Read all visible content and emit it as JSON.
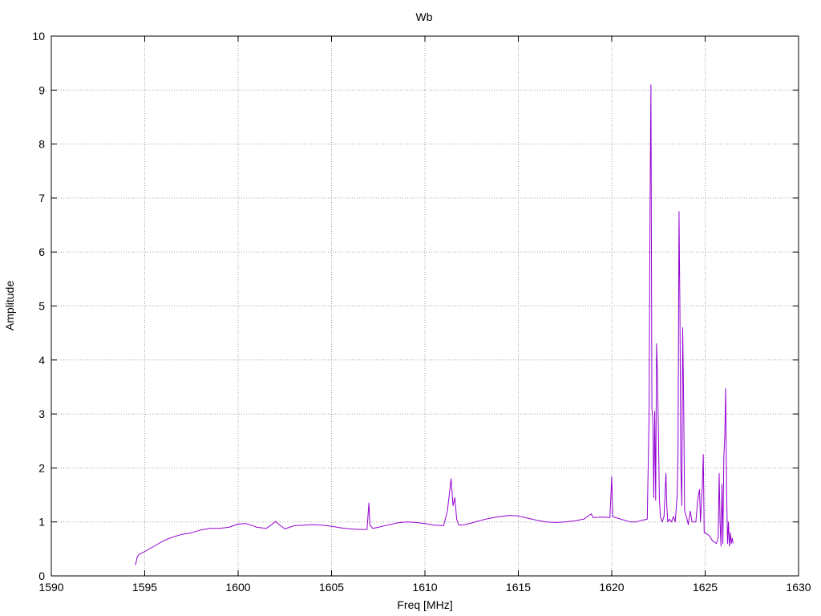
{
  "chart_data": {
    "type": "line",
    "title": "Wb",
    "xlabel": "Freq [MHz]",
    "ylabel": "Amplitude",
    "xlim": [
      1590,
      1630
    ],
    "ylim": [
      0,
      10
    ],
    "xticks": [
      1590,
      1595,
      1600,
      1605,
      1610,
      1615,
      1620,
      1625,
      1630
    ],
    "yticks": [
      0,
      1,
      2,
      3,
      4,
      5,
      6,
      7,
      8,
      9,
      10
    ],
    "grid": true,
    "legend": "none",
    "series": [
      {
        "color": "#9400d3",
        "points": [
          [
            1594.5,
            0.2
          ],
          [
            1594.6,
            0.35
          ],
          [
            1594.7,
            0.4
          ],
          [
            1595.0,
            0.45
          ],
          [
            1595.5,
            0.55
          ],
          [
            1596.0,
            0.65
          ],
          [
            1596.5,
            0.72
          ],
          [
            1597.0,
            0.77
          ],
          [
            1597.5,
            0.8
          ],
          [
            1598.0,
            0.85
          ],
          [
            1598.5,
            0.88
          ],
          [
            1599.0,
            0.88
          ],
          [
            1599.5,
            0.9
          ],
          [
            1600.0,
            0.96
          ],
          [
            1600.4,
            0.97
          ],
          [
            1600.7,
            0.94
          ],
          [
            1601.0,
            0.9
          ],
          [
            1601.5,
            0.88
          ],
          [
            1601.8,
            0.95
          ],
          [
            1602.0,
            1.01
          ],
          [
            1602.2,
            0.95
          ],
          [
            1602.5,
            0.87
          ],
          [
            1603.0,
            0.93
          ],
          [
            1603.5,
            0.94
          ],
          [
            1604.0,
            0.95
          ],
          [
            1604.5,
            0.94
          ],
          [
            1605.0,
            0.92
          ],
          [
            1605.5,
            0.89
          ],
          [
            1606.0,
            0.87
          ],
          [
            1606.5,
            0.86
          ],
          [
            1606.9,
            0.86
          ],
          [
            1607.0,
            1.35
          ],
          [
            1607.05,
            0.95
          ],
          [
            1607.2,
            0.88
          ],
          [
            1607.5,
            0.9
          ],
          [
            1608.0,
            0.94
          ],
          [
            1608.5,
            0.98
          ],
          [
            1609.0,
            1.0
          ],
          [
            1609.5,
            0.99
          ],
          [
            1610.0,
            0.97
          ],
          [
            1610.5,
            0.94
          ],
          [
            1611.0,
            0.93
          ],
          [
            1611.2,
            1.2
          ],
          [
            1611.3,
            1.5
          ],
          [
            1611.4,
            1.8
          ],
          [
            1611.5,
            1.3
          ],
          [
            1611.6,
            1.45
          ],
          [
            1611.7,
            1.05
          ],
          [
            1611.8,
            0.95
          ],
          [
            1612.0,
            0.94
          ],
          [
            1612.5,
            0.98
          ],
          [
            1613.0,
            1.03
          ],
          [
            1613.5,
            1.07
          ],
          [
            1614.0,
            1.1
          ],
          [
            1614.5,
            1.12
          ],
          [
            1615.0,
            1.11
          ],
          [
            1615.5,
            1.07
          ],
          [
            1616.0,
            1.03
          ],
          [
            1616.5,
            1.0
          ],
          [
            1617.0,
            0.99
          ],
          [
            1617.5,
            1.0
          ],
          [
            1618.0,
            1.02
          ],
          [
            1618.5,
            1.05
          ],
          [
            1618.9,
            1.15
          ],
          [
            1619.0,
            1.08
          ],
          [
            1619.5,
            1.09
          ],
          [
            1619.9,
            1.08
          ],
          [
            1620.0,
            1.84
          ],
          [
            1620.05,
            1.1
          ],
          [
            1620.3,
            1.07
          ],
          [
            1620.7,
            1.03
          ],
          [
            1621.0,
            1.0
          ],
          [
            1621.3,
            1.0
          ],
          [
            1621.6,
            1.03
          ],
          [
            1621.9,
            1.05
          ],
          [
            1622.0,
            3.0
          ],
          [
            1622.05,
            6.9
          ],
          [
            1622.1,
            9.1
          ],
          [
            1622.15,
            3.1
          ],
          [
            1622.2,
            2.9
          ],
          [
            1622.25,
            1.45
          ],
          [
            1622.3,
            3.05
          ],
          [
            1622.35,
            1.4
          ],
          [
            1622.4,
            4.3
          ],
          [
            1622.45,
            3.7
          ],
          [
            1622.5,
            2.6
          ],
          [
            1622.55,
            1.45
          ],
          [
            1622.6,
            1.1
          ],
          [
            1622.7,
            1.0
          ],
          [
            1622.8,
            1.1
          ],
          [
            1622.9,
            1.9
          ],
          [
            1622.95,
            1.3
          ],
          [
            1623.0,
            1.0
          ],
          [
            1623.1,
            1.05
          ],
          [
            1623.2,
            1.0
          ],
          [
            1623.3,
            1.1
          ],
          [
            1623.4,
            1.0
          ],
          [
            1623.5,
            1.5
          ],
          [
            1623.55,
            2.3
          ],
          [
            1623.6,
            6.75
          ],
          [
            1623.65,
            5.0
          ],
          [
            1623.7,
            2.0
          ],
          [
            1623.75,
            1.3
          ],
          [
            1623.8,
            4.6
          ],
          [
            1623.85,
            3.2
          ],
          [
            1623.9,
            1.2
          ],
          [
            1624.0,
            1.1
          ],
          [
            1624.1,
            0.95
          ],
          [
            1624.2,
            1.2
          ],
          [
            1624.3,
            1.0
          ],
          [
            1624.5,
            1.0
          ],
          [
            1624.6,
            1.4
          ],
          [
            1624.7,
            1.6
          ],
          [
            1624.75,
            1.0
          ],
          [
            1624.85,
            1.7
          ],
          [
            1624.9,
            2.25
          ],
          [
            1624.95,
            0.8
          ],
          [
            1625.0,
            0.8
          ],
          [
            1625.2,
            0.75
          ],
          [
            1625.4,
            0.65
          ],
          [
            1625.6,
            0.6
          ],
          [
            1625.7,
            0.7
          ],
          [
            1625.75,
            1.9
          ],
          [
            1625.8,
            1.0
          ],
          [
            1625.85,
            0.55
          ],
          [
            1625.9,
            1.7
          ],
          [
            1625.95,
            0.6
          ],
          [
            1626.0,
            2.2
          ],
          [
            1626.05,
            2.6
          ],
          [
            1626.1,
            3.47
          ],
          [
            1626.15,
            1.5
          ],
          [
            1626.2,
            0.6
          ],
          [
            1626.25,
            1.0
          ],
          [
            1626.3,
            0.55
          ],
          [
            1626.35,
            0.8
          ],
          [
            1626.4,
            0.6
          ],
          [
            1626.45,
            0.7
          ],
          [
            1626.5,
            0.6
          ]
        ]
      }
    ]
  }
}
